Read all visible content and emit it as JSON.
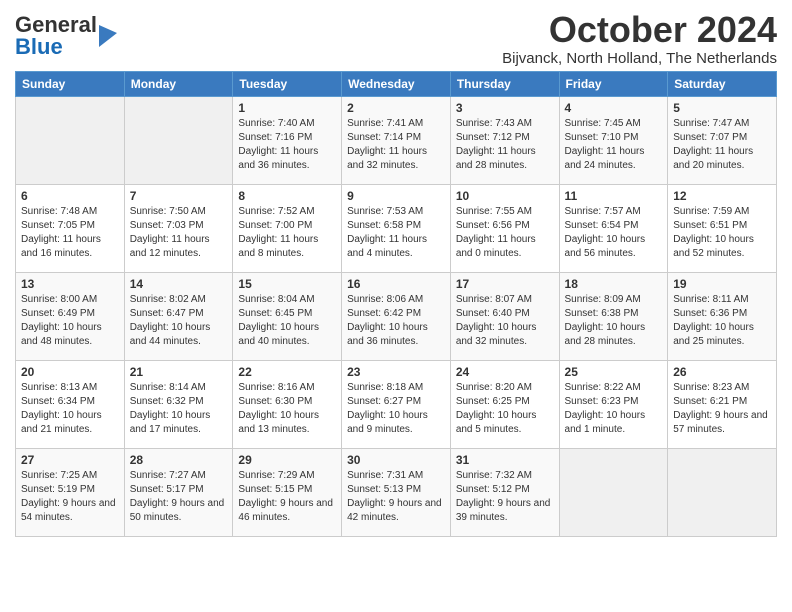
{
  "header": {
    "logo_text_general": "General",
    "logo_text_blue": "Blue",
    "month_title": "October 2024",
    "subtitle": "Bijvanck, North Holland, The Netherlands"
  },
  "days_of_week": [
    "Sunday",
    "Monday",
    "Tuesday",
    "Wednesday",
    "Thursday",
    "Friday",
    "Saturday"
  ],
  "weeks": [
    [
      {
        "day": "",
        "empty": true
      },
      {
        "day": "",
        "empty": true
      },
      {
        "day": "1",
        "sunrise": "7:40 AM",
        "sunset": "7:16 PM",
        "daylight": "11 hours and 36 minutes."
      },
      {
        "day": "2",
        "sunrise": "7:41 AM",
        "sunset": "7:14 PM",
        "daylight": "11 hours and 32 minutes."
      },
      {
        "day": "3",
        "sunrise": "7:43 AM",
        "sunset": "7:12 PM",
        "daylight": "11 hours and 28 minutes."
      },
      {
        "day": "4",
        "sunrise": "7:45 AM",
        "sunset": "7:10 PM",
        "daylight": "11 hours and 24 minutes."
      },
      {
        "day": "5",
        "sunrise": "7:47 AM",
        "sunset": "7:07 PM",
        "daylight": "11 hours and 20 minutes."
      }
    ],
    [
      {
        "day": "6",
        "sunrise": "7:48 AM",
        "sunset": "7:05 PM",
        "daylight": "11 hours and 16 minutes."
      },
      {
        "day": "7",
        "sunrise": "7:50 AM",
        "sunset": "7:03 PM",
        "daylight": "11 hours and 12 minutes."
      },
      {
        "day": "8",
        "sunrise": "7:52 AM",
        "sunset": "7:00 PM",
        "daylight": "11 hours and 8 minutes."
      },
      {
        "day": "9",
        "sunrise": "7:53 AM",
        "sunset": "6:58 PM",
        "daylight": "11 hours and 4 minutes."
      },
      {
        "day": "10",
        "sunrise": "7:55 AM",
        "sunset": "6:56 PM",
        "daylight": "11 hours and 0 minutes."
      },
      {
        "day": "11",
        "sunrise": "7:57 AM",
        "sunset": "6:54 PM",
        "daylight": "10 hours and 56 minutes."
      },
      {
        "day": "12",
        "sunrise": "7:59 AM",
        "sunset": "6:51 PM",
        "daylight": "10 hours and 52 minutes."
      }
    ],
    [
      {
        "day": "13",
        "sunrise": "8:00 AM",
        "sunset": "6:49 PM",
        "daylight": "10 hours and 48 minutes."
      },
      {
        "day": "14",
        "sunrise": "8:02 AM",
        "sunset": "6:47 PM",
        "daylight": "10 hours and 44 minutes."
      },
      {
        "day": "15",
        "sunrise": "8:04 AM",
        "sunset": "6:45 PM",
        "daylight": "10 hours and 40 minutes."
      },
      {
        "day": "16",
        "sunrise": "8:06 AM",
        "sunset": "6:42 PM",
        "daylight": "10 hours and 36 minutes."
      },
      {
        "day": "17",
        "sunrise": "8:07 AM",
        "sunset": "6:40 PM",
        "daylight": "10 hours and 32 minutes."
      },
      {
        "day": "18",
        "sunrise": "8:09 AM",
        "sunset": "6:38 PM",
        "daylight": "10 hours and 28 minutes."
      },
      {
        "day": "19",
        "sunrise": "8:11 AM",
        "sunset": "6:36 PM",
        "daylight": "10 hours and 25 minutes."
      }
    ],
    [
      {
        "day": "20",
        "sunrise": "8:13 AM",
        "sunset": "6:34 PM",
        "daylight": "10 hours and 21 minutes."
      },
      {
        "day": "21",
        "sunrise": "8:14 AM",
        "sunset": "6:32 PM",
        "daylight": "10 hours and 17 minutes."
      },
      {
        "day": "22",
        "sunrise": "8:16 AM",
        "sunset": "6:30 PM",
        "daylight": "10 hours and 13 minutes."
      },
      {
        "day": "23",
        "sunrise": "8:18 AM",
        "sunset": "6:27 PM",
        "daylight": "10 hours and 9 minutes."
      },
      {
        "day": "24",
        "sunrise": "8:20 AM",
        "sunset": "6:25 PM",
        "daylight": "10 hours and 5 minutes."
      },
      {
        "day": "25",
        "sunrise": "8:22 AM",
        "sunset": "6:23 PM",
        "daylight": "10 hours and 1 minute."
      },
      {
        "day": "26",
        "sunrise": "8:23 AM",
        "sunset": "6:21 PM",
        "daylight": "9 hours and 57 minutes."
      }
    ],
    [
      {
        "day": "27",
        "sunrise": "7:25 AM",
        "sunset": "5:19 PM",
        "daylight": "9 hours and 54 minutes."
      },
      {
        "day": "28",
        "sunrise": "7:27 AM",
        "sunset": "5:17 PM",
        "daylight": "9 hours and 50 minutes."
      },
      {
        "day": "29",
        "sunrise": "7:29 AM",
        "sunset": "5:15 PM",
        "daylight": "9 hours and 46 minutes."
      },
      {
        "day": "30",
        "sunrise": "7:31 AM",
        "sunset": "5:13 PM",
        "daylight": "9 hours and 42 minutes."
      },
      {
        "day": "31",
        "sunrise": "7:32 AM",
        "sunset": "5:12 PM",
        "daylight": "9 hours and 39 minutes."
      },
      {
        "day": "",
        "empty": true
      },
      {
        "day": "",
        "empty": true
      }
    ]
  ],
  "labels": {
    "sunrise_prefix": "Sunrise: ",
    "sunset_prefix": "Sunset: ",
    "daylight_prefix": "Daylight: "
  }
}
